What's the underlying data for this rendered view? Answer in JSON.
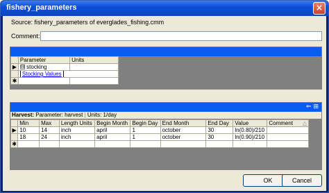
{
  "window": {
    "title": "fishery_parameters",
    "close_glyph": "×"
  },
  "source": {
    "text": "Source:  fishery_parameters  of  everglades_fishing.cmm"
  },
  "comment": {
    "label": "Comment:",
    "value": ""
  },
  "parameters_grid": {
    "columns": [
      "Parameter",
      "Units"
    ],
    "rows": [
      {
        "marker": "▶",
        "expander": "⊟",
        "parameter": "stocking",
        "units": ""
      }
    ],
    "child_link": "Stocking Values",
    "new_row_marker": "✱"
  },
  "harvest_grid": {
    "title_label": "Harvest:",
    "parameter_label": "Parameter:",
    "parameter_value": "harvest",
    "units_label": "Units:",
    "units_value": "1/day",
    "band_icons": "⇐ ⊞",
    "columns": [
      "Min",
      "Max",
      "Length Units",
      "Begin Month",
      "Begin Day",
      "End Month",
      "End Day",
      "Value",
      "Comment"
    ],
    "sort_glyph": "△",
    "rows": [
      {
        "marker": "▶",
        "cells": [
          "10",
          "14",
          "inch",
          "april",
          "1",
          "october",
          "30",
          "ln(0.80)/210",
          ""
        ]
      },
      {
        "marker": "",
        "cells": [
          "18",
          "24",
          "inch",
          "april",
          "1",
          "october",
          "30",
          "ln(0.90)/210",
          ""
        ]
      }
    ],
    "new_row_marker": "✱"
  },
  "buttons": {
    "ok": "OK",
    "cancel": "Cancel"
  }
}
